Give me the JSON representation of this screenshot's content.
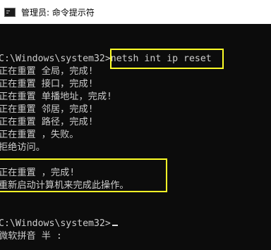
{
  "window": {
    "title": "管理员: 命令提示符",
    "icon": "cmd-icon"
  },
  "console": {
    "lines": [
      "C:\\Windows\\system32>netsh int ip reset",
      "正在重置 全局，完成!",
      "正在重置 接口，完成!",
      "正在重置 单播地址，完成!",
      "正在重置 邻居，完成!",
      "正在重置 路径，完成!",
      "正在重置 ，失败。",
      "拒绝访问。",
      "",
      "正在重置 ，完成!",
      "重新启动计算机来完成此操作。",
      "",
      "",
      "C:\\Windows\\system32>",
      "微软拼音 半 :"
    ],
    "prompt": "C:\\Windows\\system32>",
    "command": "netsh int ip reset",
    "ime_status": "微软拼音 半 :"
  },
  "colors": {
    "background": "#0c0c0c",
    "text": "#cccccc",
    "highlight": "#ffff27"
  }
}
